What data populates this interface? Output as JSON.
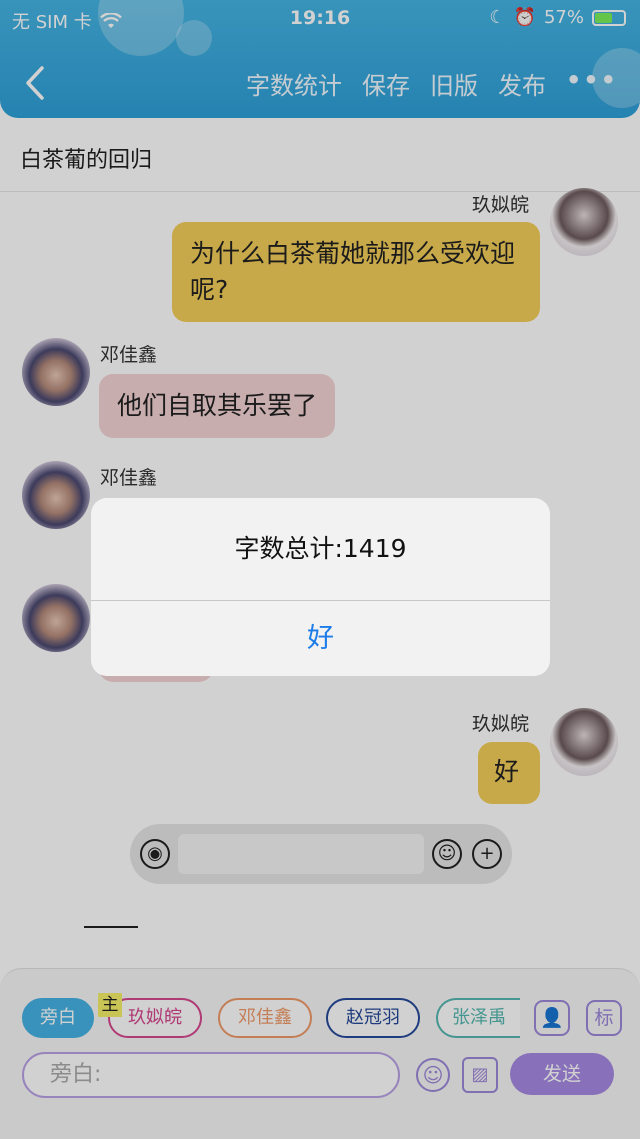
{
  "status_bar": {
    "carrier": "无 SIM 卡",
    "time": "19:16",
    "battery": "57%"
  },
  "nav": {
    "actions": [
      "字数统计",
      "保存",
      "旧版",
      "发布"
    ],
    "more": "•••"
  },
  "story_title": "白茶葡的回归",
  "messages": [
    {
      "speaker": "玖姒皖",
      "text": "为什么白茶葡她就那么受欢迎呢?"
    },
    {
      "speaker": "邓佳鑫",
      "text": "他们自取其乐罢了"
    },
    {
      "speaker": "邓佳鑫",
      "text": ""
    },
    {
      "speaker": "玖姒皖",
      "text": "好"
    }
  ],
  "roles": {
    "narrator": "旁白",
    "host_badge": "主",
    "r1": "玖姒皖",
    "r2": "邓佳鑫",
    "r3": "赵冠羽",
    "r4": "张泽禹",
    "tag": "标"
  },
  "composer": {
    "placeholder": "旁白:",
    "send": "发送"
  },
  "alert": {
    "message": "字数总计:1419",
    "button": "好"
  },
  "colors": {
    "header": "#2ea0d8",
    "accent_purple": "#a78ae3",
    "alert_button": "#1c7ce8"
  }
}
